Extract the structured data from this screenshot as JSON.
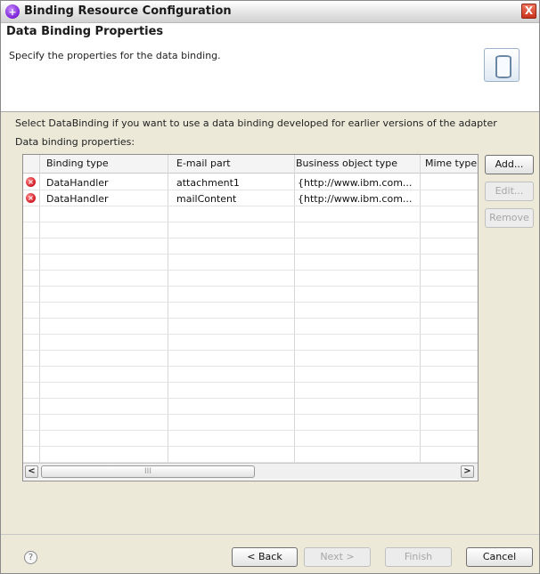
{
  "window": {
    "title": "Binding Resource Configuration",
    "close_glyph": "X"
  },
  "header": {
    "title": "Data Binding Properties",
    "description": "Specify the properties for the data binding.",
    "icon": "database-cylinder-icon"
  },
  "content": {
    "intro": "Select DataBinding if you want to use a data binding developed for earlier versions of the adapter",
    "section_label": "Data binding properties:"
  },
  "table": {
    "columns": [
      "Binding type",
      "E-mail part",
      "Business object type",
      "Mime type"
    ],
    "rows": [
      {
        "status_icon": "error-icon",
        "binding_type": "DataHandler",
        "email_part": "attachment1",
        "bo_type": "{http://www.ibm.com...",
        "mime_type": ""
      },
      {
        "status_icon": "error-icon",
        "binding_type": "DataHandler",
        "email_part": "mailContent",
        "bo_type": "{http://www.ibm.com...",
        "mime_type": ""
      }
    ],
    "scroll_left": "<",
    "scroll_right": ">",
    "scroll_grip": "III"
  },
  "side_buttons": {
    "add": "Add...",
    "edit": "Edit...",
    "remove": "Remove"
  },
  "footer": {
    "help": "?",
    "back": "< Back",
    "next": "Next >",
    "finish": "Finish",
    "cancel": "Cancel"
  }
}
